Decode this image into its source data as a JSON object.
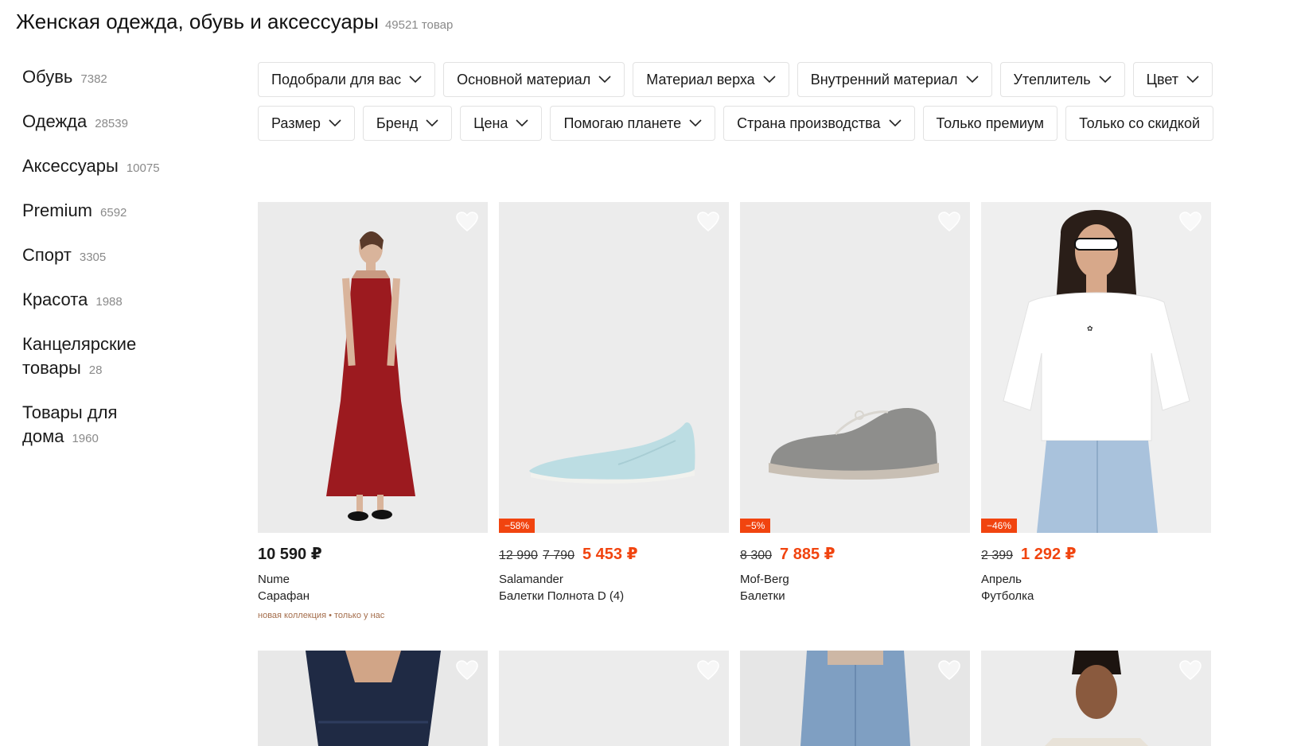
{
  "header": {
    "title": "Женская одежда, обувь и аксессуары",
    "count": "49521 товар"
  },
  "sidebar": {
    "items": [
      {
        "label": "Обувь",
        "count": "7382"
      },
      {
        "label": "Одежда",
        "count": "28539"
      },
      {
        "label": "Аксессуары",
        "count": "10075"
      },
      {
        "label": "Premium",
        "count": "6592"
      },
      {
        "label": "Спорт",
        "count": "3305"
      },
      {
        "label": "Красота",
        "count": "1988"
      },
      {
        "label_line1": "Канцелярские",
        "label_line2": "товары",
        "count": "28"
      },
      {
        "label_line1": "Товары для",
        "label_line2": "дома",
        "count": "1960"
      }
    ]
  },
  "filters": [
    "Подобрали для вас",
    "Основной материал",
    "Материал верха",
    "Внутренний материал",
    "Утеплитель",
    "Цвет",
    "Размер",
    "Бренд",
    "Цена",
    "Помогаю планете",
    "Страна производства",
    "Только премиум",
    "Только со скидкой"
  ],
  "products": [
    {
      "price": "10 590 ₽",
      "old_price": "",
      "old_price2": "",
      "discount": "",
      "brand": "Nume",
      "name": "Сарафан",
      "tags": "новая коллекция • только у нас"
    },
    {
      "price": "5 453 ₽",
      "old_price": "12 990",
      "old_price2": "7 790",
      "discount": "−58%",
      "brand": "Salamander",
      "name": "Балетки Полнота D (4)",
      "tags": ""
    },
    {
      "price": "7 885 ₽",
      "old_price": "8 300",
      "old_price2": "",
      "discount": "−5%",
      "brand": "Mof-Berg",
      "name": "Балетки",
      "tags": ""
    },
    {
      "price": "1 292 ₽",
      "old_price": "2 399",
      "old_price2": "",
      "discount": "−46%",
      "brand": "Апрель",
      "name": "Футболка",
      "tags": ""
    }
  ],
  "colors": {
    "accent": "#f1440f",
    "muted": "#8a8a8a",
    "tag": "#a46d4b"
  }
}
